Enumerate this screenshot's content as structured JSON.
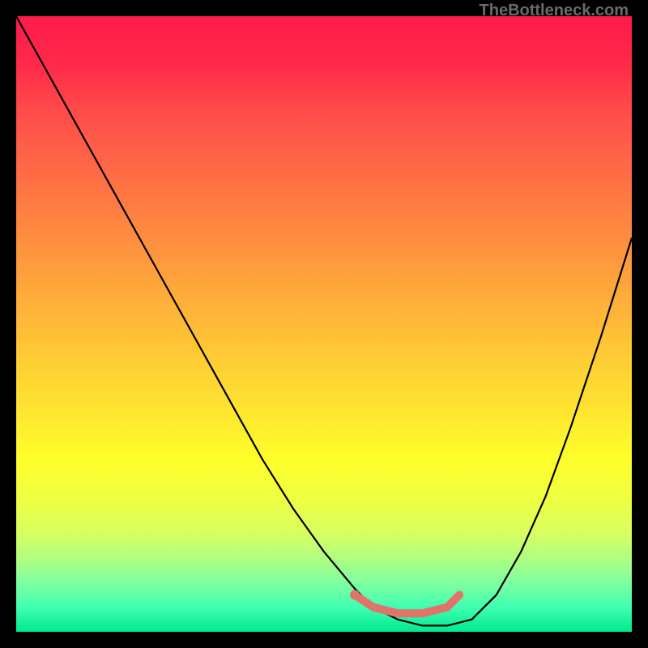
{
  "watermark": "TheBottleneck.com",
  "chart_data": {
    "type": "line",
    "title": "",
    "xlabel": "",
    "ylabel": "",
    "xlim": [
      0,
      100
    ],
    "ylim": [
      0,
      100
    ],
    "series": [
      {
        "name": "curve",
        "color": "#000000",
        "x": [
          0,
          5,
          10,
          15,
          20,
          25,
          30,
          35,
          40,
          45,
          50,
          55,
          58,
          62,
          66,
          70,
          74,
          78,
          82,
          86,
          90,
          95,
          100
        ],
        "y": [
          100,
          91,
          82,
          73,
          64,
          55,
          46,
          37,
          28,
          20,
          13,
          7,
          4,
          2,
          1,
          1,
          2,
          6,
          13,
          22,
          33,
          48,
          64
        ]
      },
      {
        "name": "highlight",
        "color": "#e2736b",
        "x": [
          55,
          58,
          62,
          66,
          70,
          72
        ],
        "y": [
          6,
          4,
          3,
          3,
          4,
          6
        ]
      }
    ]
  }
}
